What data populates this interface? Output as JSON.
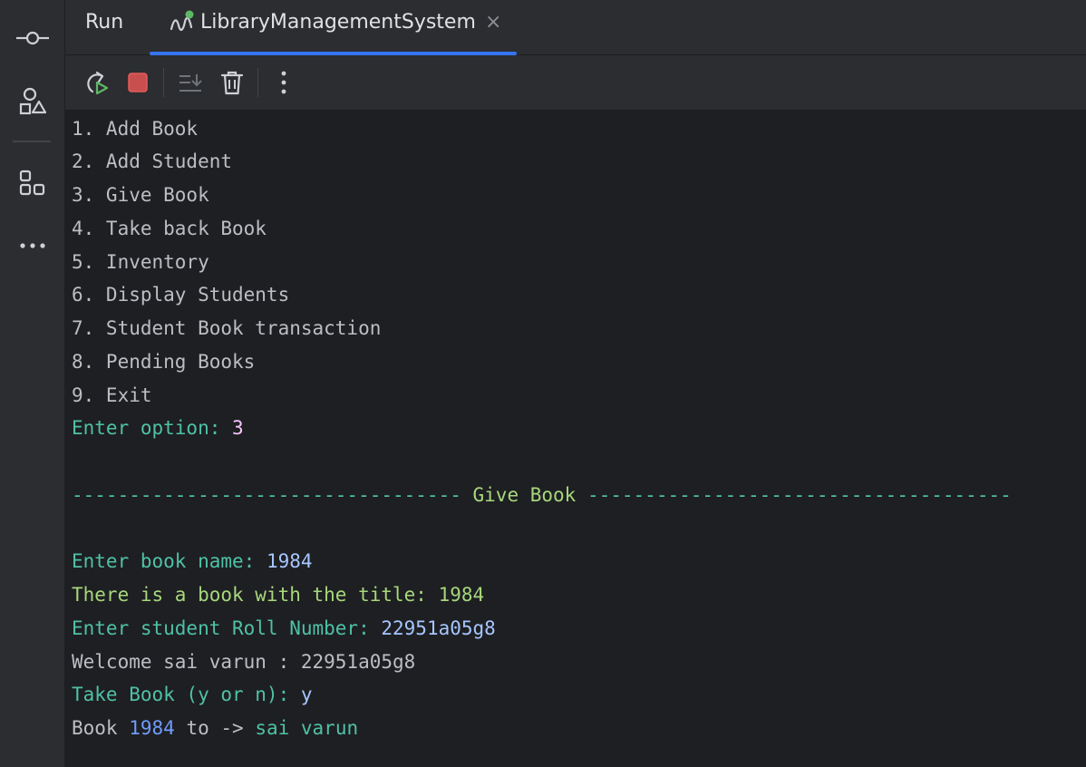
{
  "header": {
    "run_label": "Run",
    "tab_title": "LibraryManagementSystem",
    "close_glyph": "×"
  },
  "toolbar": {
    "icons": [
      "rerun-icon",
      "stop-icon",
      "scroll-to-end-icon",
      "clear-all-icon",
      "more-options-icon"
    ]
  },
  "left_strip": {
    "icons": [
      "commit-icon",
      "shapes-icon",
      "structure-icon",
      "more-icon"
    ]
  },
  "console": {
    "menu": [
      "1. Add Book",
      "2. Add Student",
      "3. Give Book",
      "4. Take back Book",
      "5. Inventory",
      "6. Display Students",
      "7. Student Book transaction",
      "8. Pending Books",
      "9. Exit"
    ],
    "enter_option_prompt": "Enter option: ",
    "enter_option_value": "3",
    "divider_left": "---------------------------------- ",
    "divider_title": "Give Book",
    "divider_right": " -------------------------------------",
    "book_name_prompt": "Enter book name: ",
    "book_name_value": "1984",
    "book_found_text": "There is a book with the title: 1984",
    "roll_prompt": "Enter student Roll Number: ",
    "roll_value": "22951a05g8",
    "welcome_text": "Welcome sai varun : 22951a05g8",
    "take_prompt": "Take Book (y or n): ",
    "take_value": "y",
    "result_prefix": "Book ",
    "result_book": "1984",
    "result_middle": " to -> ",
    "result_student": "sai varun"
  },
  "colors": {
    "prompt": "#4fc1a6",
    "input": "#a6c6ff",
    "accent_tab": "#3574f0",
    "stop": "#e55b5b",
    "running_dot": "#5fb865"
  }
}
